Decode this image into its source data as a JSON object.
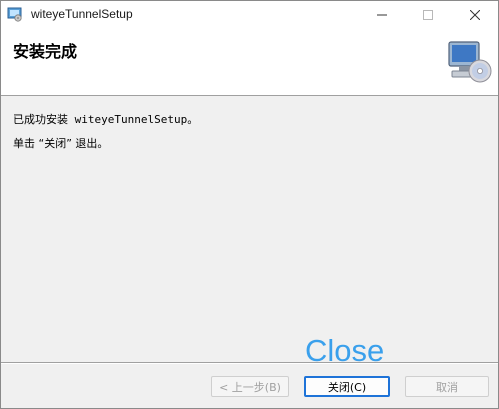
{
  "window": {
    "title": "witeyeTunnelSetup"
  },
  "header": {
    "title": "安装完成",
    "logo_icon": "computer-cd-icon"
  },
  "content": {
    "line1": "已成功安装 witeyeTunnelSetup。",
    "line2": "单击 “关闭” 退出。"
  },
  "overlay": {
    "label": "Close",
    "color": "#3aa0ec"
  },
  "buttons": {
    "back": "< 上一步(B)",
    "close": "关闭(C)",
    "cancel": "取消"
  },
  "colors": {
    "accent": "#1e73d8",
    "disabled_text": "#a0a0a0"
  }
}
